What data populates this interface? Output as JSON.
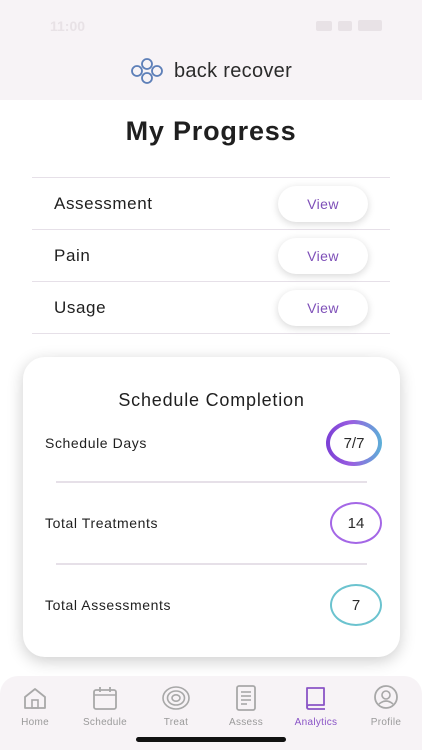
{
  "status_bar": {
    "time": "11:00"
  },
  "brand": {
    "name": "back recover",
    "icon": "four-rings-logo-icon"
  },
  "page": {
    "title": "My Progress"
  },
  "progress_items": [
    {
      "label": "Assessment",
      "button_label": "View"
    },
    {
      "label": "Pain",
      "button_label": "View"
    },
    {
      "label": "Usage",
      "button_label": "View"
    }
  ],
  "schedule_card": {
    "title": "Schedule Completion",
    "stats": [
      {
        "label": "Schedule Days",
        "value": "7/7",
        "ring_color": "gradient-purple-teal"
      },
      {
        "label": "Total Treatments",
        "value": "14",
        "ring_color": "#a467e6"
      },
      {
        "label": "Total Assessments",
        "value": "7",
        "ring_color": "#6bc3cf"
      }
    ]
  },
  "tabs": [
    {
      "label": "Home",
      "icon": "home-icon",
      "active": false
    },
    {
      "label": "Schedule",
      "icon": "calendar-icon",
      "active": false
    },
    {
      "label": "Treat",
      "icon": "target-icon",
      "active": false
    },
    {
      "label": "Assess",
      "icon": "clipboard-icon",
      "active": false
    },
    {
      "label": "Analytics",
      "icon": "book-icon",
      "active": true
    },
    {
      "label": "Profile",
      "icon": "user-circle-icon",
      "active": false
    }
  ],
  "colors": {
    "accent": "#8a54c6",
    "header_bg": "#f7f3f6",
    "divider": "#e6e0e8"
  }
}
